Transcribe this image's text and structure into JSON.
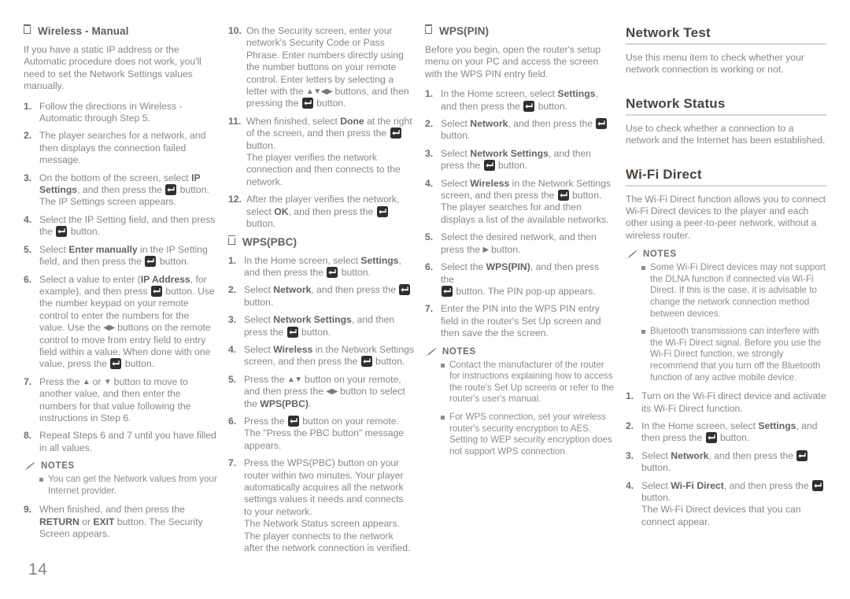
{
  "page": {
    "number": "14",
    "accent_heading_color": "#4b4540",
    "body_text_color": "#88878b",
    "rule_color": "#d9d6d2",
    "icon_button_color": "#2f2f31"
  },
  "icons": {
    "enter_button": "enter-button-icon",
    "notes_pencil": "pencil-icon",
    "bullet_square": "square-bullet-icon",
    "up": "▲",
    "down": "▼",
    "left": "◀",
    "right": "▶"
  },
  "column1": {
    "subhead": "Wireless - Manual",
    "intro": "If you have a static IP address or the Automatic procedure does not work, you'll need to set the Network Settings values manually.",
    "steps": [
      {
        "num": "1.",
        "parts": [
          {
            "t": "Follow the directions in Wireless - Automatic through Step 5."
          }
        ]
      },
      {
        "num": "2.",
        "parts": [
          {
            "t": "The player searches for a network, and then displays the connection failed message."
          }
        ]
      },
      {
        "num": "3.",
        "parts": [
          {
            "t": "On the bottom of the screen, select "
          },
          {
            "b": "IP Settings"
          },
          {
            "t": ", and then press the "
          },
          {
            "icon": "enter-button-icon"
          },
          {
            "t": " button."
          },
          {
            "br": true
          },
          {
            "t": "The IP Settings screen appears."
          }
        ]
      },
      {
        "num": "4.",
        "parts": [
          {
            "t": "Select the IP Setting field, and then press the "
          },
          {
            "icon": "enter-button-icon"
          },
          {
            "t": " button."
          }
        ]
      },
      {
        "num": "5.",
        "parts": [
          {
            "t": "Select "
          },
          {
            "b": "Enter manually"
          },
          {
            "t": " in the IP Setting field, and then press the "
          },
          {
            "icon": "enter-button-icon"
          },
          {
            "t": " button."
          }
        ]
      },
      {
        "num": "6.",
        "parts": [
          {
            "t": "Select a value to enter ("
          },
          {
            "b": "IP Address"
          },
          {
            "t": ", for example), and then press "
          },
          {
            "icon": "enter-button-icon"
          },
          {
            "t": " button. Use the number keypad on your remote control to enter the numbers for the value. Use the "
          },
          {
            "arrow": "◀▶"
          },
          {
            "t": " buttons on the remote control to move from entry field to entry field within a value. When done with one value, press the "
          },
          {
            "icon": "enter-button-icon"
          },
          {
            "t": " button."
          }
        ]
      },
      {
        "num": "7.",
        "parts": [
          {
            "t": "Press the "
          },
          {
            "arrow": "▲"
          },
          {
            "t": " or "
          },
          {
            "arrow": "▼"
          },
          {
            "t": " button to move to another value, and then enter the numbers for that value following the instructions in Step 6."
          }
        ]
      },
      {
        "num": "8.",
        "parts": [
          {
            "t": "Repeat Steps 6 and 7 until you have filled in all values."
          }
        ]
      }
    ],
    "notes_title": "NOTES",
    "notes": [
      "You can get the Network values from your Internet provider."
    ],
    "steps_after_notes": [
      {
        "num": "9.",
        "parts": [
          {
            "t": "When finished, and then press the "
          },
          {
            "b": "RETURN"
          },
          {
            "t": " or "
          },
          {
            "b": "EXIT"
          },
          {
            "t": " button. The Security Screen appears."
          }
        ]
      }
    ]
  },
  "column2": {
    "steps_top": [
      {
        "num": "10.",
        "parts": [
          {
            "t": "On the Security screen, enter your network's Security Code or Pass Phrase. Enter numbers directly using the number buttons on your remote control. Enter letters by selecting a letter with the "
          },
          {
            "arrow": "▲▼◀▶"
          },
          {
            "t": " buttons, and then pressing the "
          },
          {
            "icon": "enter-button-icon"
          },
          {
            "t": " button."
          }
        ]
      },
      {
        "num": "11.",
        "parts": [
          {
            "t": "When finished, select "
          },
          {
            "b": "Done"
          },
          {
            "t": " at the right of the screen, and then press the "
          },
          {
            "icon": "enter-button-icon"
          },
          {
            "t": " button."
          },
          {
            "br": true
          },
          {
            "t": "The player verifies the network connection and then connects to the network."
          }
        ]
      },
      {
        "num": "12.",
        "parts": [
          {
            "t": "After the player verifies the network, select "
          },
          {
            "b": "OK"
          },
          {
            "t": ", and then press the "
          },
          {
            "icon": "enter-button-icon"
          },
          {
            "t": " button."
          }
        ]
      }
    ],
    "subhead": "WPS(PBC)",
    "steps": [
      {
        "num": "1.",
        "parts": [
          {
            "t": "In the Home screen, select "
          },
          {
            "b": "Settings"
          },
          {
            "t": ", and then press the "
          },
          {
            "icon": "enter-button-icon"
          },
          {
            "t": " button."
          }
        ]
      },
      {
        "num": "2.",
        "parts": [
          {
            "t": "Select "
          },
          {
            "b": "Network"
          },
          {
            "t": ", and then press the "
          },
          {
            "icon": "enter-button-icon"
          },
          {
            "t": " button."
          }
        ]
      },
      {
        "num": "3.",
        "parts": [
          {
            "t": "Select "
          },
          {
            "b": "Network Settings"
          },
          {
            "t": ", and then press the "
          },
          {
            "icon": "enter-button-icon"
          },
          {
            "t": " button."
          }
        ]
      },
      {
        "num": "4.",
        "parts": [
          {
            "t": "Select "
          },
          {
            "b": "Wireless"
          },
          {
            "t": " in the Network Settings screen, and then press the "
          },
          {
            "icon": "enter-button-icon"
          },
          {
            "t": " button."
          }
        ]
      },
      {
        "num": "5.",
        "parts": [
          {
            "t": "Press the "
          },
          {
            "arrow": "▲▼"
          },
          {
            "t": " button on your remote, and then press the "
          },
          {
            "arrow": "◀▶"
          },
          {
            "t": " button to select the "
          },
          {
            "b": "WPS(PBC)"
          },
          {
            "t": "."
          }
        ]
      },
      {
        "num": "6.",
        "parts": [
          {
            "t": "Press the "
          },
          {
            "icon": "enter-button-icon"
          },
          {
            "t": " button on your remote."
          },
          {
            "br": true
          },
          {
            "t": "The \"Press the PBC button\" message appears."
          }
        ]
      },
      {
        "num": "7.",
        "parts": [
          {
            "t": "Press the WPS(PBC) button on your router within two minutes. Your player automatically acquires all the network settings values it needs and connects to your network."
          },
          {
            "br": true
          },
          {
            "t": "The Network Status screen appears. The player connects to the network after the network connection is verified."
          }
        ]
      }
    ]
  },
  "column3": {
    "subhead": "WPS(PIN)",
    "intro": "Before you begin, open the router's setup menu on your PC and access the screen with the WPS PIN entry field.",
    "steps": [
      {
        "num": "1.",
        "parts": [
          {
            "t": "In the Home screen, select "
          },
          {
            "b": "Settings"
          },
          {
            "t": ", and then press the "
          },
          {
            "icon": "enter-button-icon"
          },
          {
            "t": " button."
          }
        ]
      },
      {
        "num": "2.",
        "parts": [
          {
            "t": "Select "
          },
          {
            "b": "Network"
          },
          {
            "t": ", and then press the "
          },
          {
            "icon": "enter-button-icon"
          },
          {
            "t": " button."
          }
        ]
      },
      {
        "num": "3.",
        "parts": [
          {
            "t": "Select "
          },
          {
            "b": "Network Settings"
          },
          {
            "t": ", and then press the "
          },
          {
            "icon": "enter-button-icon"
          },
          {
            "t": " button."
          }
        ]
      },
      {
        "num": "4.",
        "parts": [
          {
            "t": "Select "
          },
          {
            "b": "Wireless"
          },
          {
            "t": " in the Network Settings screen, and then press the "
          },
          {
            "icon": "enter-button-icon"
          },
          {
            "t": " button."
          },
          {
            "br": true
          },
          {
            "t": "The player searches for and then displays a list of the available networks."
          }
        ]
      },
      {
        "num": "5.",
        "parts": [
          {
            "t": "Select the desired network, and then press the "
          },
          {
            "arrow": "▶"
          },
          {
            "t": " button."
          }
        ]
      },
      {
        "num": "6.",
        "parts": [
          {
            "t": "Select the "
          },
          {
            "b": "WPS(PIN)"
          },
          {
            "t": ", and then press the"
          },
          {
            "br": true
          },
          {
            "icon": "enter-button-icon"
          },
          {
            "t": " button. The PIN pop-up appears."
          }
        ]
      },
      {
        "num": "7.",
        "parts": [
          {
            "t": "Enter the PIN into the WPS PIN entry field in the router's Set Up screen and then save the the screen."
          }
        ]
      }
    ],
    "notes_title": "NOTES",
    "notes": [
      "Contact the manufacturer of the router for instructions explaining how to access the route's Set Up screens or refer to the router's user's manual.",
      "For WPS connection, set your wireless router's security encryption to AES. Setting to WEP security encryption does not support WPS connection."
    ]
  },
  "column4": {
    "sections": [
      {
        "title": "Network Test",
        "body": "Use this menu item to check whether your network connection is working or not."
      },
      {
        "title": "Network Status",
        "body": "Use to check whether a connection to a network and the Internet has been established."
      }
    ],
    "wifi_title": "Wi-Fi Direct",
    "wifi_body": "The Wi-Fi Direct function allows you to connect Wi-Fi Direct devices to the player and each other using a peer-to-peer network, without a wireless router.",
    "notes_title": "NOTES",
    "notes": [
      "Some Wi-Fi Direct devices may not support the DLNA function if connected via Wi-Fi Direct. If this is the case, it is advisable to change the network connection method between devices.",
      "Bluetooth transmissions can interfere with the Wi-Fi Direct signal. Before you use the Wi-Fi Direct function, we strongly recommend that you turn off the Bluetooth function of any active mobile device."
    ],
    "steps": [
      {
        "num": "1.",
        "parts": [
          {
            "t": "Turn on the Wi-Fi direct device and activate its Wi-Fi Direct function."
          }
        ]
      },
      {
        "num": "2.",
        "parts": [
          {
            "t": "In the Home screen, select "
          },
          {
            "b": "Settings"
          },
          {
            "t": ", and then press the "
          },
          {
            "icon": "enter-button-icon"
          },
          {
            "t": " button."
          }
        ]
      },
      {
        "num": "3.",
        "parts": [
          {
            "t": "Select "
          },
          {
            "b": "Network"
          },
          {
            "t": ", and then press the "
          },
          {
            "icon": "enter-button-icon"
          },
          {
            "t": " button."
          }
        ]
      },
      {
        "num": "4.",
        "parts": [
          {
            "t": "Select "
          },
          {
            "b": "Wi-Fi Direct"
          },
          {
            "t": ", and then press the "
          },
          {
            "icon": "enter-button-icon"
          },
          {
            "t": " button."
          },
          {
            "br": true
          },
          {
            "t": "The Wi-Fi Direct devices that you can connect appear."
          }
        ]
      }
    ]
  }
}
